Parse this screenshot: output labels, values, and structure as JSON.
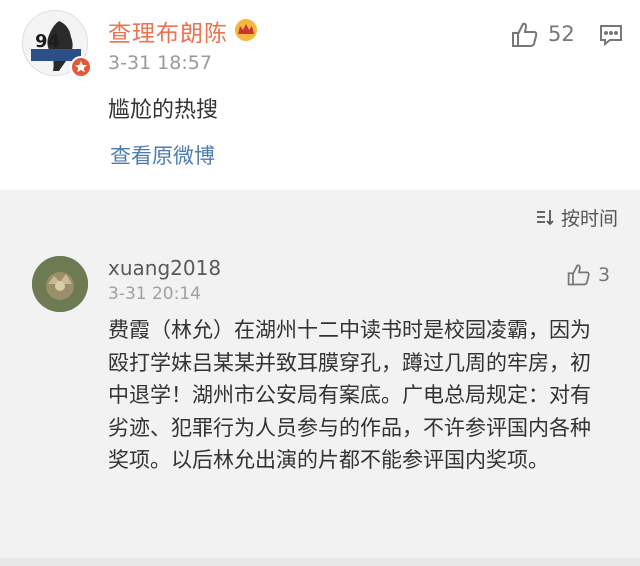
{
  "post": {
    "username": "查理布朗陈",
    "avatar_text": "94",
    "time": "3-31 18:57",
    "text": "尴尬的热搜",
    "view_original": "查看原微博",
    "likes": "52",
    "icons": {
      "crown": "crown-icon",
      "like": "thumbs-up-icon",
      "comment": "comment-icon"
    }
  },
  "comments": {
    "sort_label": "按时间",
    "items": [
      {
        "username": "xuang2018",
        "time": "3-31 20:14",
        "likes": "3",
        "text": "费霞（林允）在湖州十二中读书时是校园凌霸，因为殴打学妹吕某某并致耳膜穿孔，蹲过几周的牢房，初中退学！湖州市公安局有案底。广电总局规定：对有劣迹、犯罪行为人员参与的作品，不许参评国内各种奖项。以后林允出演的片都不能参评国内奖项。"
      }
    ]
  },
  "colors": {
    "username": "#eb7350",
    "link": "#4f7cae",
    "comment_bg": "#f2f2f2"
  }
}
